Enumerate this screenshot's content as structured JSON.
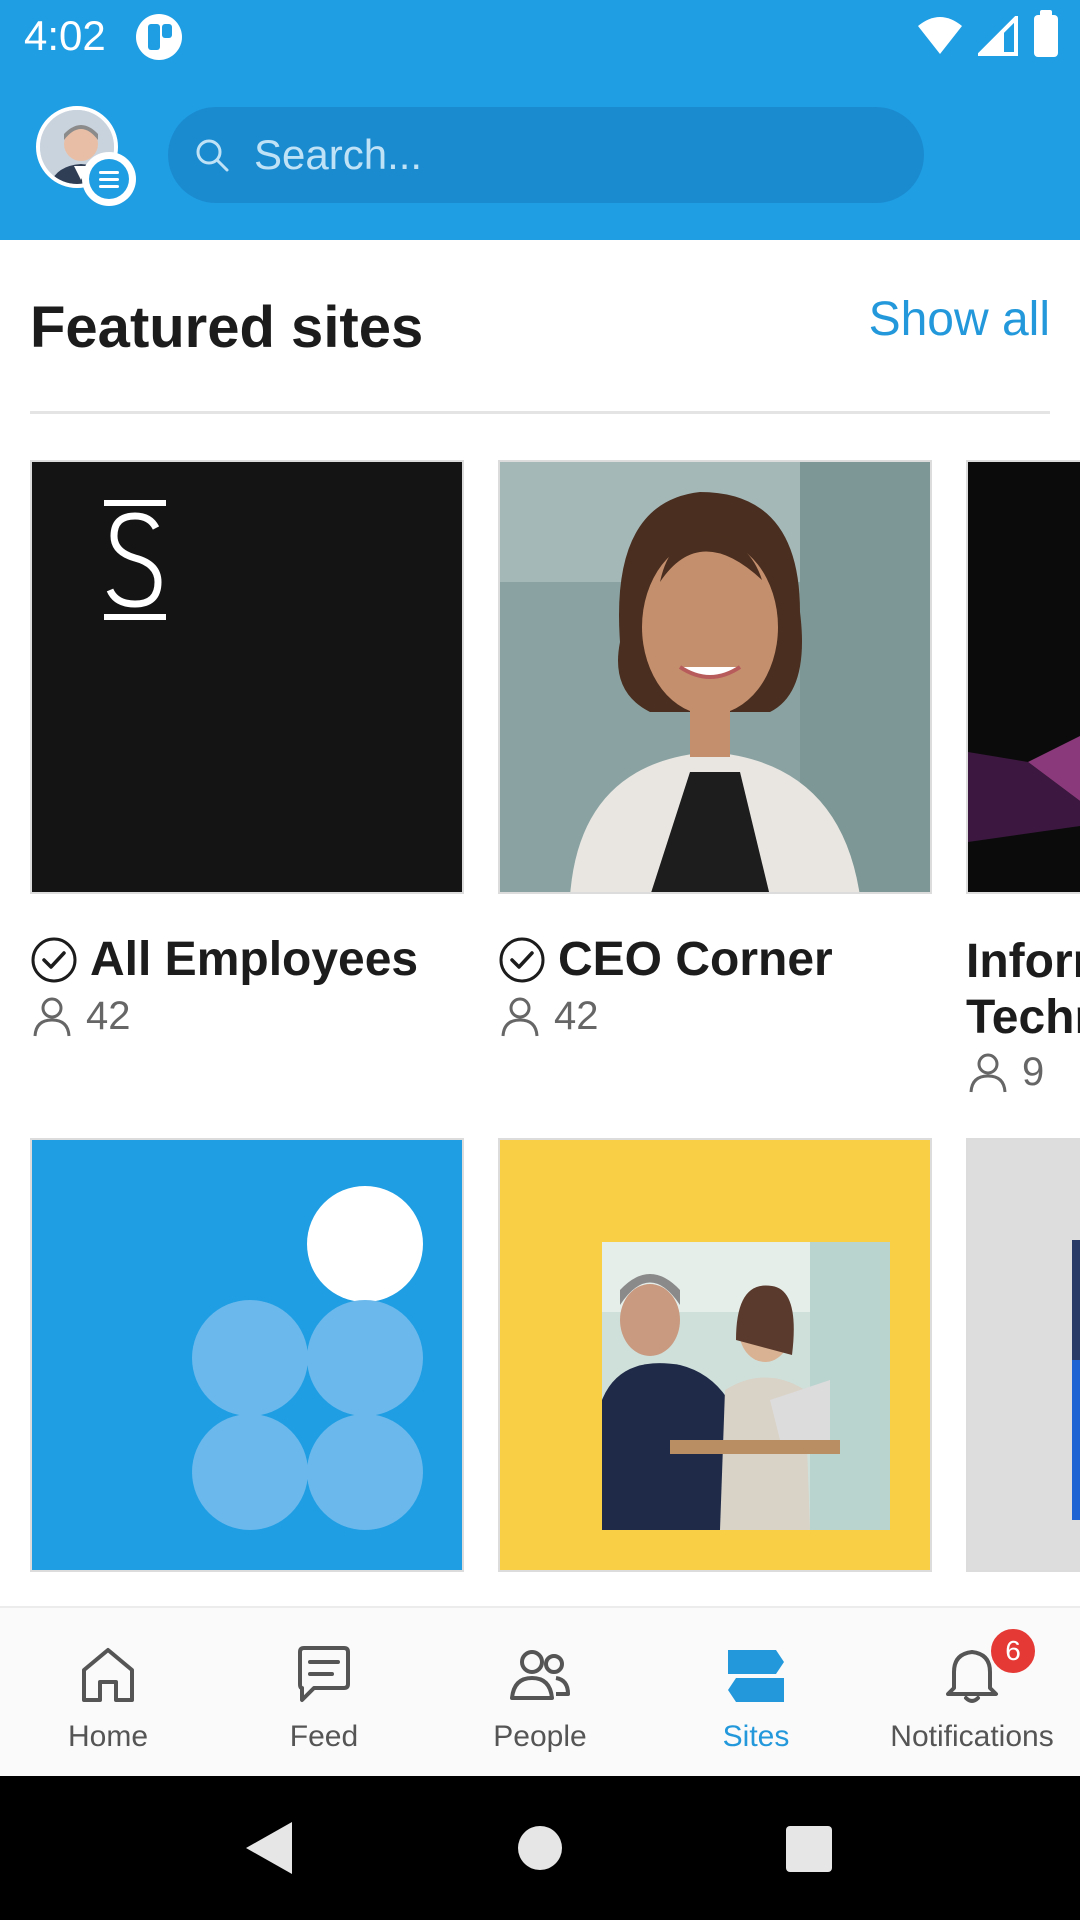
{
  "status_bar": {
    "time": "4:02"
  },
  "header": {
    "search": {
      "placeholder": "Search..."
    }
  },
  "featured": {
    "title": "Featured sites",
    "show_all_label": "Show all"
  },
  "cards": [
    {
      "name": "All Employees",
      "members": "42",
      "following": true
    },
    {
      "name": "CEO Corner",
      "members": "42",
      "following": true
    },
    {
      "name_line1": "Inforr",
      "name_line2": "Techr",
      "members": "9"
    }
  ],
  "bottom_nav": {
    "items": [
      {
        "label": "Home",
        "icon": "home-icon"
      },
      {
        "label": "Feed",
        "icon": "feed-icon"
      },
      {
        "label": "People",
        "icon": "people-icon"
      },
      {
        "label": "Sites",
        "icon": "sites-icon",
        "active": true
      },
      {
        "label": "Notifications",
        "icon": "bell-icon",
        "badge": "6"
      }
    ]
  },
  "colors": {
    "brand_blue": "#1f9ee4",
    "link_blue": "#2399db",
    "badge_red": "#e53935",
    "tile_yellow": "#f8cf45"
  }
}
